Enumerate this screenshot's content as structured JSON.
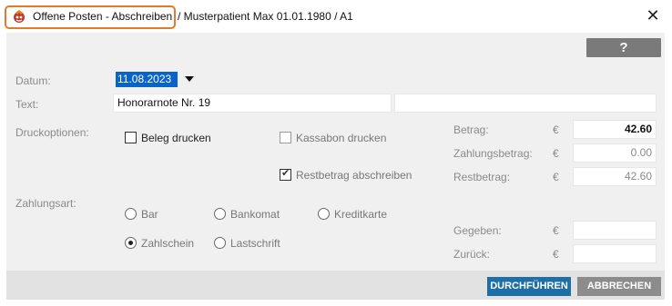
{
  "window": {
    "title_main": "Offene Posten - Abschreiben",
    "title_sub": "/ Musterpatient Max 01.01.1980 / A1",
    "close_label": "✕"
  },
  "toolbar": {
    "help_label": "?"
  },
  "form": {
    "datum_label": "Datum:",
    "datum_value": "11.08.2023",
    "text_label": "Text:",
    "text_value": "Honorarnote Nr. 19",
    "text_value_2": "",
    "druckoptionen_label": "Druckoptionen:",
    "beleg_label": "Beleg drucken",
    "beleg_checked": false,
    "kassabon_label": "Kassabon drucken",
    "kassabon_checked": false,
    "restbetrag_abschreiben_label": "Restbetrag abschreiben",
    "restbetrag_abschreiben_checked": true,
    "zahlungsart_label": "Zahlungsart:",
    "payment_options": [
      {
        "label": "Bar",
        "selected": false
      },
      {
        "label": "Bankomat",
        "selected": false
      },
      {
        "label": "Kreditkarte",
        "selected": false
      },
      {
        "label": "Zahlschein",
        "selected": true
      },
      {
        "label": "Lastschrift",
        "selected": false
      }
    ]
  },
  "amounts": {
    "currency": "€",
    "betrag_label": "Betrag:",
    "betrag_value": "42.60",
    "zahlungsbetrag_label": "Zahlungsbetrag:",
    "zahlungsbetrag_value": "0.00",
    "restbetrag_label": "Restbetrag:",
    "restbetrag_value": "42.60",
    "gegeben_label": "Gegeben:",
    "gegeben_value": "",
    "zurueck_label": "Zurück:",
    "zurueck_value": ""
  },
  "buttons": {
    "execute_label": "DURCHFÜHREN",
    "cancel_label": "ABBRECHEN"
  },
  "colors": {
    "highlight": "#e07b2a",
    "primary_button": "#1e6fa8",
    "secondary_button": "#8c8c8c",
    "help_button": "#7a7a7a",
    "date_selection": "#0a63c9"
  }
}
